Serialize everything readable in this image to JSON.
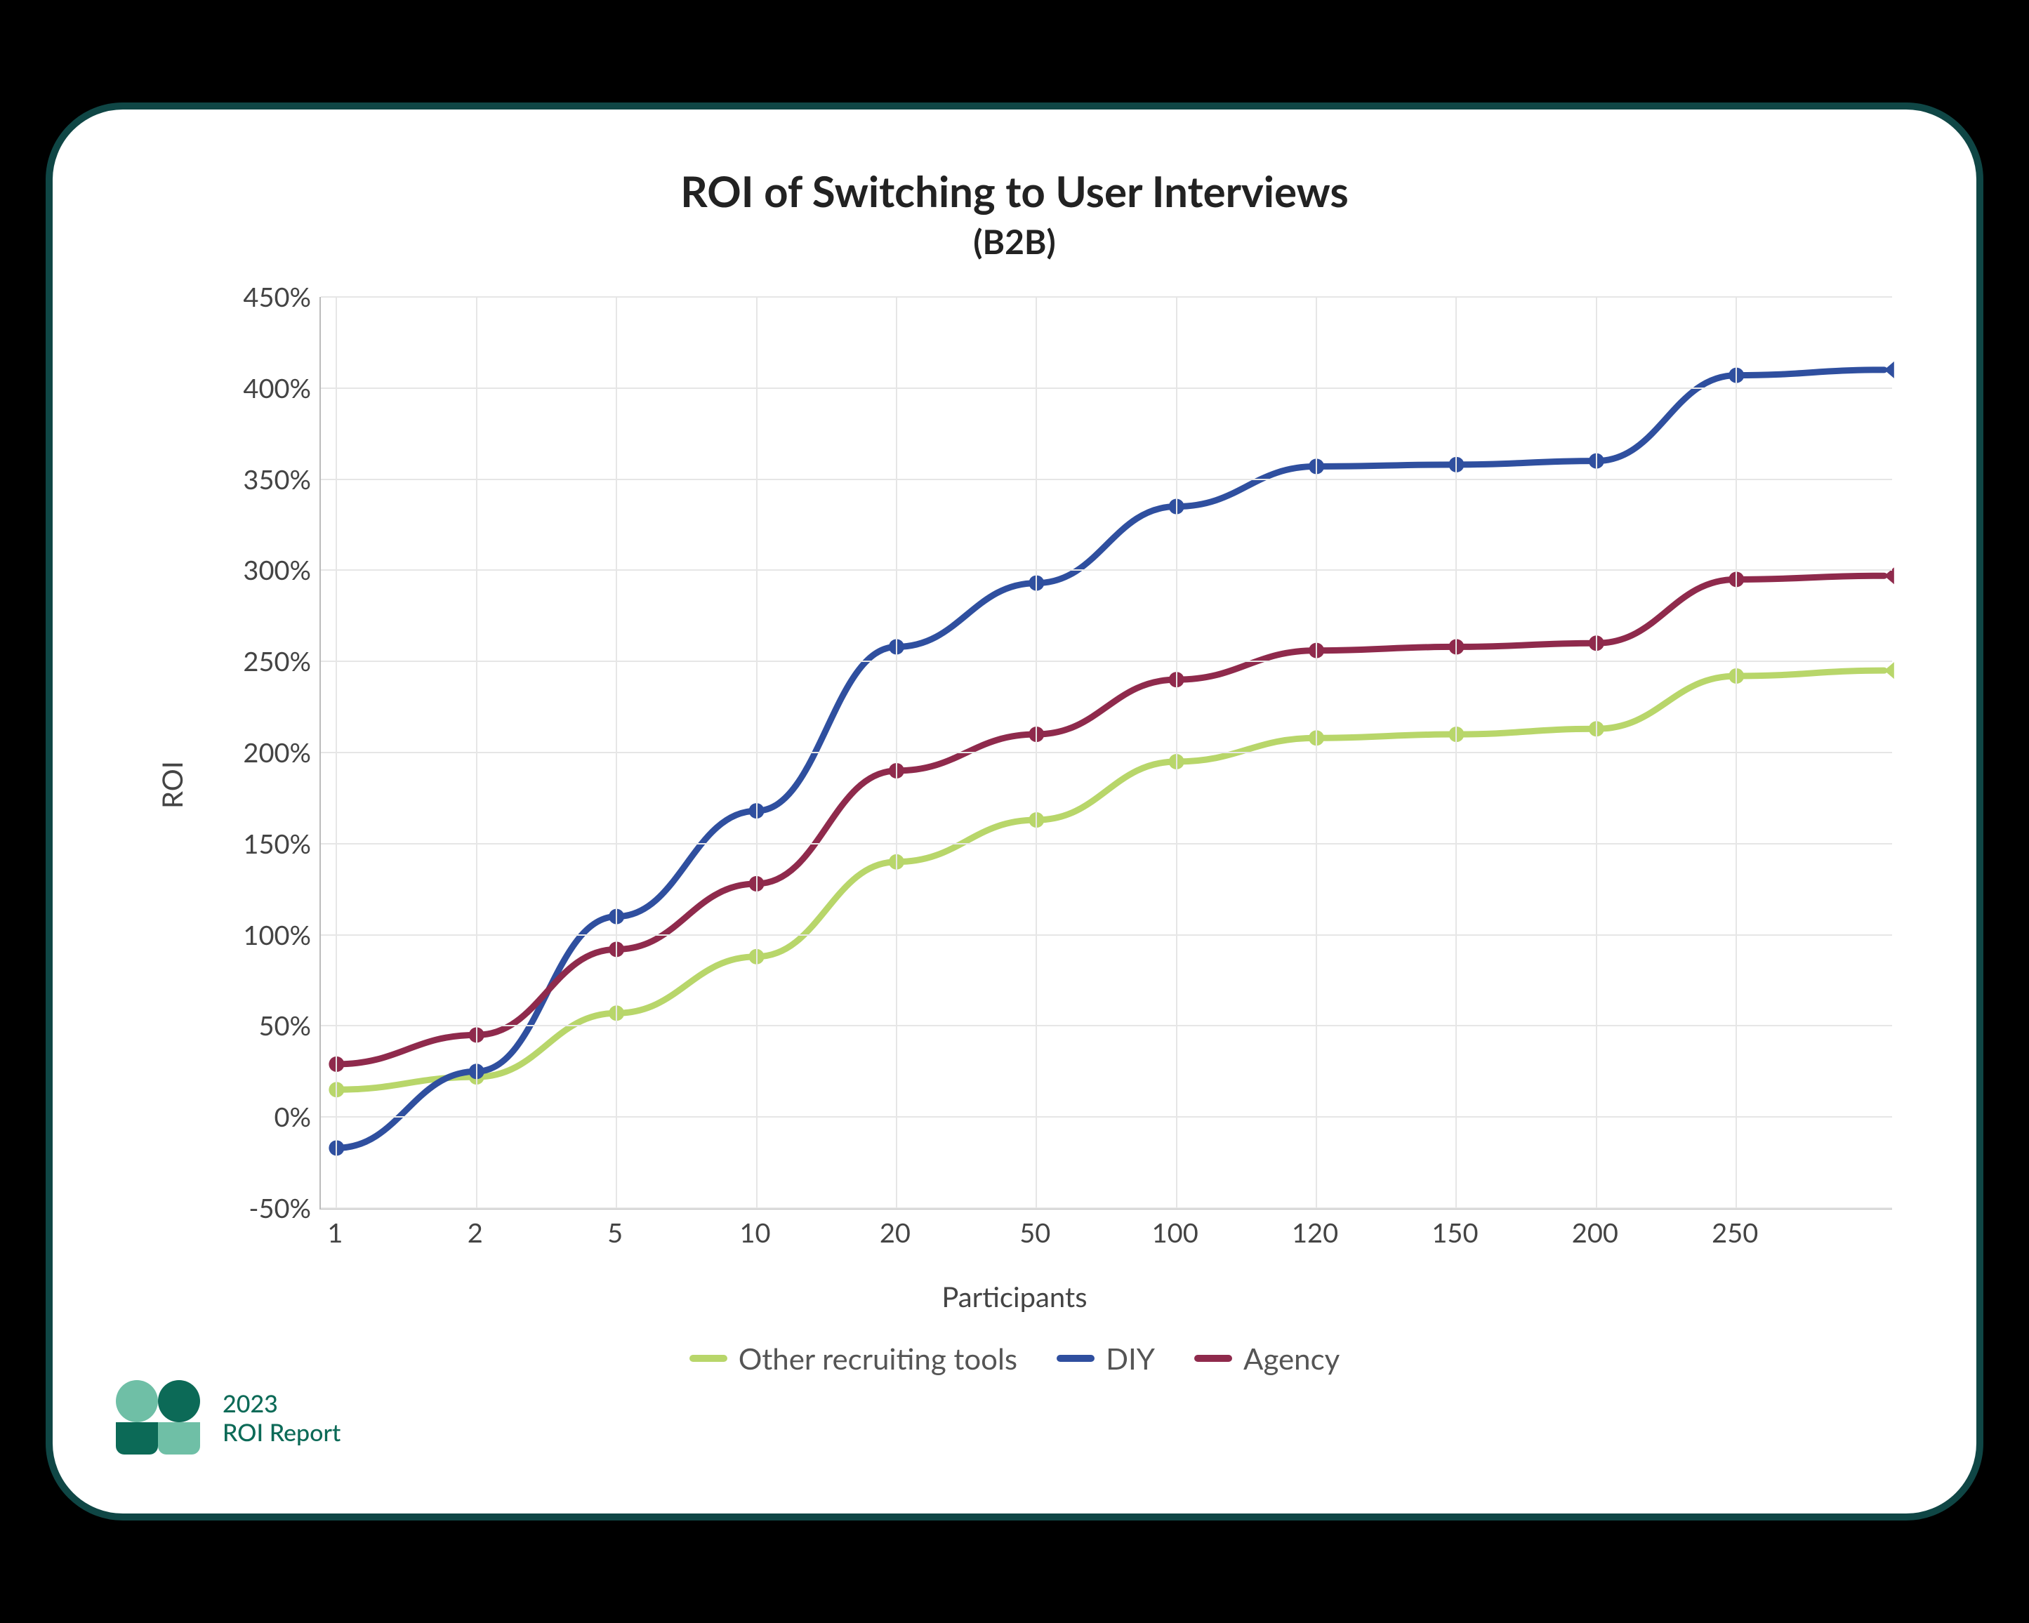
{
  "chart_data": {
    "type": "line",
    "title": "ROI of Switching to User Interviews",
    "subtitle": "(B2B)",
    "xlabel": "Participants",
    "ylabel": "ROI",
    "x_categories": [
      "1",
      "2",
      "5",
      "10",
      "20",
      "50",
      "100",
      "120",
      "150",
      "200",
      "250"
    ],
    "y_ticks": [
      "-50%",
      "0%",
      "50%",
      "100%",
      "150%",
      "200%",
      "250%",
      "300%",
      "350%",
      "400%",
      "450%"
    ],
    "ylim": [
      -50,
      450
    ],
    "series": [
      {
        "name": "Other recruiting tools",
        "color": "#b8d66a",
        "values": [
          15,
          22,
          57,
          88,
          140,
          163,
          195,
          208,
          210,
          213,
          242
        ],
        "end": 245
      },
      {
        "name": "DIY",
        "color": "#2f4f9f",
        "values": [
          -17,
          25,
          110,
          168,
          258,
          293,
          335,
          357,
          358,
          360,
          407
        ],
        "end": 410
      },
      {
        "name": "Agency",
        "color": "#8f2a4c",
        "values": [
          29,
          45,
          92,
          128,
          190,
          210,
          240,
          256,
          258,
          260,
          295
        ],
        "end": 297
      }
    ],
    "legend": [
      {
        "label": "Other recruiting tools",
        "color": "#b8d66a"
      },
      {
        "label": "DIY",
        "color": "#2f4f9f"
      },
      {
        "label": "Agency",
        "color": "#8f2a4c"
      }
    ]
  },
  "footer": {
    "year": "2023",
    "label": "ROI Report"
  }
}
